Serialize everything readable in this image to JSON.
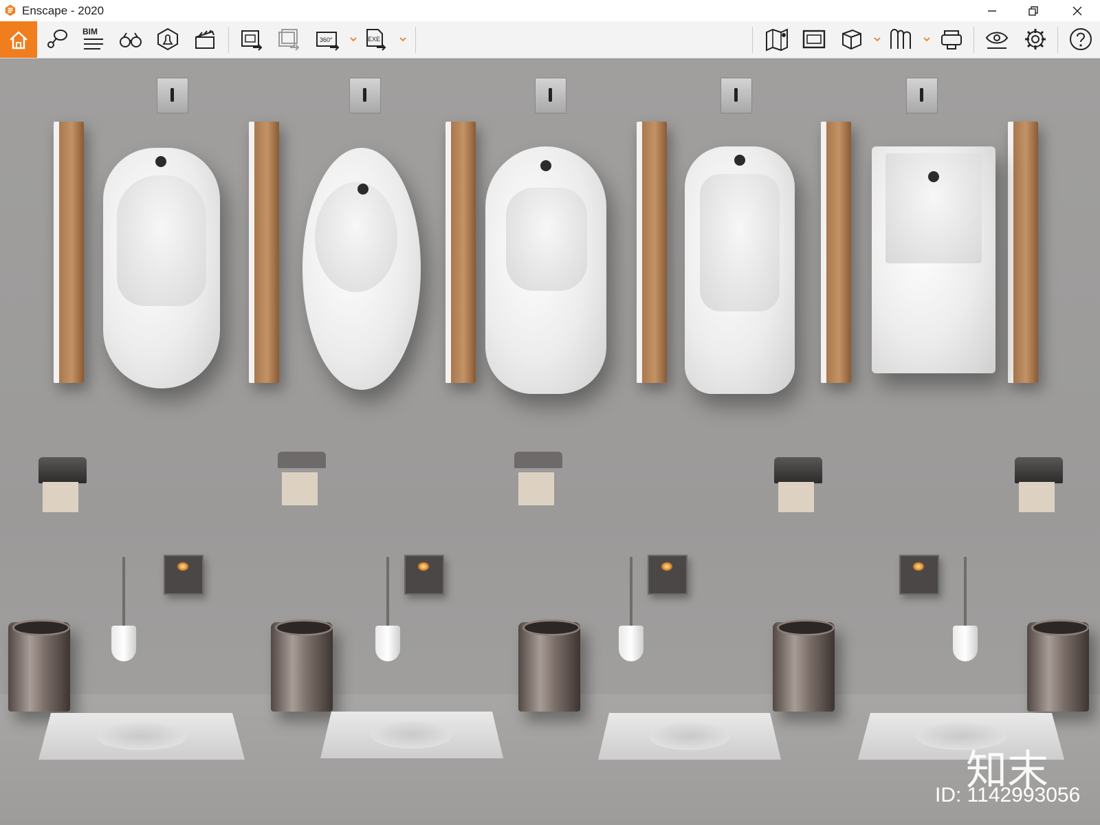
{
  "window": {
    "title": "Enscape - 2020",
    "controls": [
      "minimize",
      "restore",
      "close"
    ]
  },
  "toolbar": {
    "left_buttons": [
      {
        "name": "home",
        "icon": "home-icon",
        "active": true
      },
      {
        "name": "views",
        "icon": "map-pin-icon"
      },
      {
        "name": "bim",
        "icon": "bim-list-icon",
        "label": "BIM"
      },
      {
        "name": "binoculars",
        "icon": "binoculars-icon"
      },
      {
        "name": "sun",
        "icon": "bell-icon"
      },
      {
        "name": "video",
        "icon": "clapperboard-icon"
      },
      {
        "name": "screenshot",
        "icon": "render-export-icon"
      },
      {
        "name": "batch",
        "icon": "batch-render-icon"
      },
      {
        "name": "panorama",
        "icon": "panorama-360-icon",
        "label": "360°"
      },
      {
        "name": "exe",
        "icon": "exe-export-icon",
        "label": "EXE"
      }
    ],
    "right_buttons": [
      {
        "name": "map",
        "icon": "map-icon"
      },
      {
        "name": "screen",
        "icon": "screen-icon"
      },
      {
        "name": "asset",
        "icon": "cube-icon"
      },
      {
        "name": "library",
        "icon": "library-icon"
      },
      {
        "name": "vr",
        "icon": "vr-headset-icon"
      },
      {
        "name": "visual",
        "icon": "eye-settings-icon"
      },
      {
        "name": "settings",
        "icon": "gear-icon"
      },
      {
        "name": "help",
        "icon": "help-icon"
      }
    ],
    "accent": "#f07d1e"
  },
  "watermark": {
    "logo": "知末",
    "id": "ID: 1142993056"
  }
}
